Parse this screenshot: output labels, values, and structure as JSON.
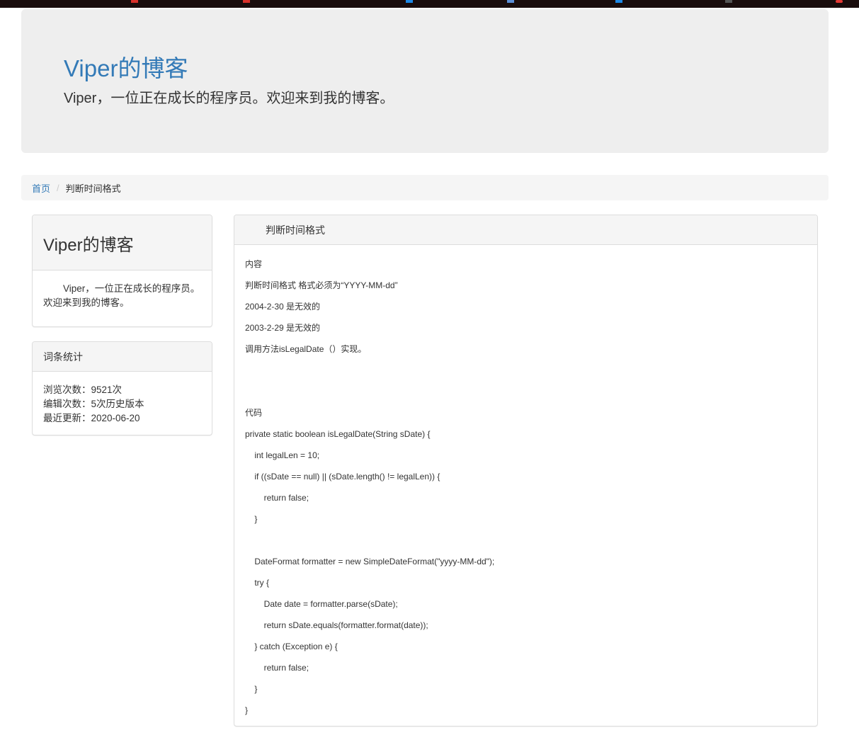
{
  "site": {
    "title": "Viper的博客",
    "tagline": "Viper，一位正在成长的程序员。欢迎来到我的博客。"
  },
  "breadcrumb": {
    "home": "首页",
    "separator": "/",
    "current": "判断时间格式"
  },
  "sidebar": {
    "about": {
      "title": "Viper的博客",
      "description": "Viper，一位正在成长的程序员。欢迎来到我的博客。"
    },
    "stats": {
      "title": "词条统计",
      "rows": [
        "浏览次数：9521次",
        "编辑次数：5次历史版本",
        "最近更新：2020-06-20"
      ]
    }
  },
  "article": {
    "title": "判断时间格式",
    "lines": [
      "内容",
      "判断时间格式 格式必须为“YYYY-MM-dd”",
      "2004-2-30 是无效的",
      "2003-2-29 是无效的",
      "调用方法isLegalDate（）实现。",
      "",
      "",
      "代码",
      "private static boolean isLegalDate(String sDate) {",
      "    int legalLen = 10;",
      "    if ((sDate == null) || (sDate.length() != legalLen)) {",
      "        return false;",
      "    }",
      "",
      "    DateFormat formatter = new SimpleDateFormat(\"yyyy-MM-dd\");",
      "    try {",
      "        Date date = formatter.parse(sDate);",
      "        return sDate.equals(formatter.format(date));",
      "    } catch (Exception e) {",
      "        return false;",
      "    }",
      "}"
    ]
  },
  "colors": {
    "link": "#337ab7",
    "jumbotron_bg": "#eeeeee",
    "panel_heading_bg": "#f5f5f5",
    "text": "#333333"
  }
}
